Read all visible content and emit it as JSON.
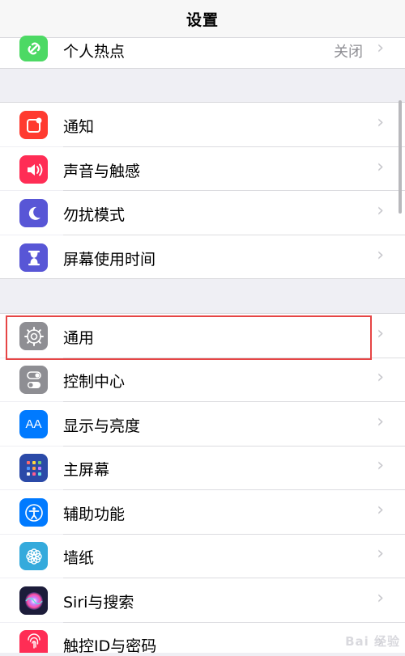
{
  "nav": {
    "title": "设置"
  },
  "rows": {
    "hotspot": {
      "label": "个人热点",
      "value": "关闭",
      "icon": "hotspot-chain-icon",
      "color": "#4cd964"
    },
    "notifications": {
      "label": "通知",
      "icon": "notification-icon",
      "color": "#ff3b30"
    },
    "sounds": {
      "label": "声音与触感",
      "icon": "speaker-icon",
      "color": "#ff2d55"
    },
    "dnd": {
      "label": "勿扰模式",
      "icon": "moon-icon",
      "color": "#5856d6"
    },
    "screentime": {
      "label": "屏幕使用时间",
      "icon": "hourglass-icon",
      "color": "#5856d6"
    },
    "general": {
      "label": "通用",
      "icon": "gear-icon",
      "color": "#8e8e93"
    },
    "control": {
      "label": "控制中心",
      "icon": "toggle-switch-icon",
      "color": "#8e8e93"
    },
    "display": {
      "label": "显示与亮度",
      "icon_text": "AA",
      "icon": "text-size-icon",
      "color": "#007aff"
    },
    "home": {
      "label": "主屏幕",
      "icon": "app-grid-icon",
      "color": "#2b4aa8"
    },
    "accessibility": {
      "label": "辅助功能",
      "icon": "accessibility-person-icon",
      "color": "#007aff"
    },
    "wallpaper": {
      "label": "墙纸",
      "icon": "flower-icon",
      "color": "#34aadc"
    },
    "siri": {
      "label": "Siri与搜索",
      "icon": "siri-orb-icon",
      "color": "#1c1c3a"
    },
    "touchid": {
      "label": "触控ID与密码",
      "icon": "fingerprint-icon",
      "color": "#ff2d55"
    }
  },
  "watermark": "Bai 经验"
}
